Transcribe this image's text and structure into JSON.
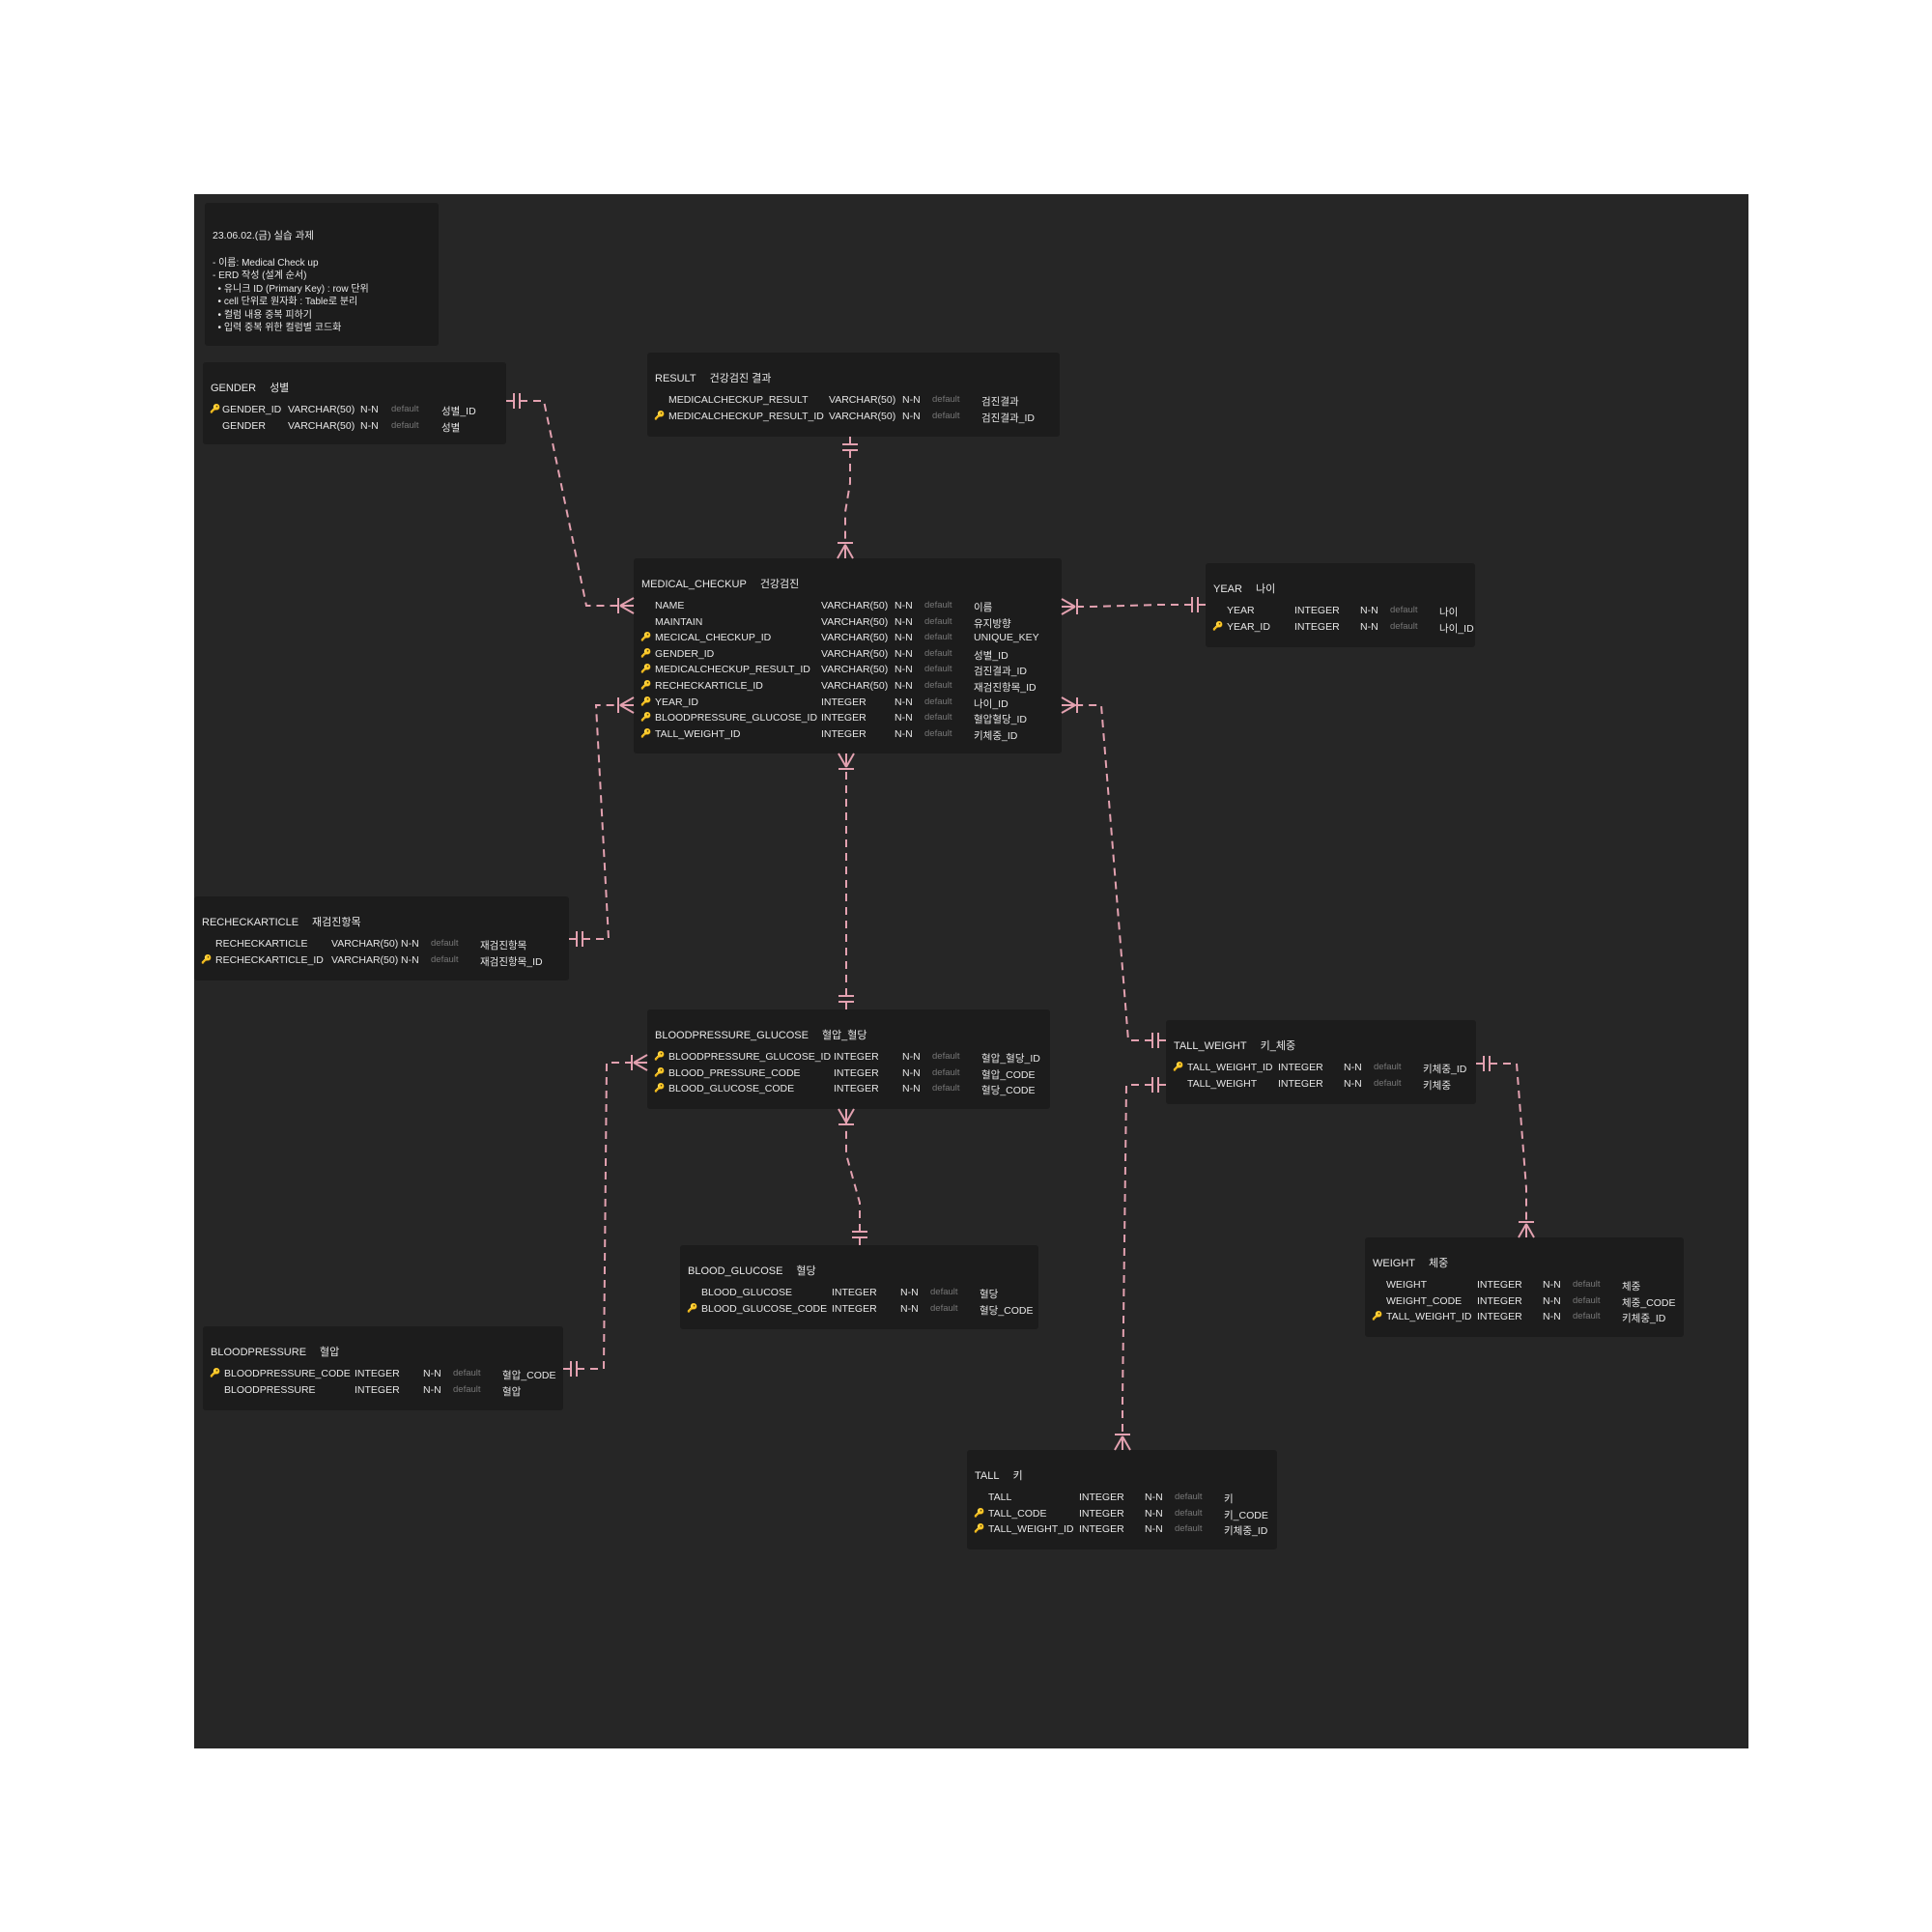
{
  "colors": {
    "canvas": "#262626",
    "table": "#1c1c1c",
    "relation": "#e3a1b0",
    "primary_key": "#d9c435",
    "foreign_key": "#d98ea0"
  },
  "memo": {
    "title": "23.06.02.(금)    실습 과제",
    "lines": [
      "- 이름: Medical Check up",
      "- ERD 작성 (설계 순서)",
      "  • 유니크 ID (Primary Key) : row 단위",
      "  • cell 단위로 원자화 : Table로 분리",
      "  • 컬럼 내용 중복 피하기",
      "  • 입력 중복 위한 컬럼별 코드화"
    ]
  },
  "tables": [
    {
      "id": "gender",
      "name": "GENDER",
      "logical": "성별",
      "columns": [
        {
          "key": "pk",
          "name": "GENDER_ID",
          "type": "VARCHAR(50)",
          "nn": "N-N",
          "default": "default",
          "comment": "성별_ID"
        },
        {
          "key": "",
          "name": "GENDER",
          "type": "VARCHAR(50)",
          "nn": "N-N",
          "default": "default",
          "comment": "성별"
        }
      ]
    },
    {
      "id": "result",
      "name": "RESULT",
      "logical": "건강검진 결과",
      "columns": [
        {
          "key": "",
          "name": "MEDICALCHECKUP_RESULT",
          "type": "VARCHAR(50)",
          "nn": "N-N",
          "default": "default",
          "comment": "검진결과"
        },
        {
          "key": "pk",
          "name": "MEDICALCHECKUP_RESULT_ID",
          "type": "VARCHAR(50)",
          "nn": "N-N",
          "default": "default",
          "comment": "검진결과_ID"
        }
      ]
    },
    {
      "id": "medical",
      "name": "MEDICAL_CHECKUP",
      "logical": "건강검진",
      "columns": [
        {
          "key": "",
          "name": "NAME",
          "type": "VARCHAR(50)",
          "nn": "N-N",
          "default": "default",
          "comment": "이름"
        },
        {
          "key": "",
          "name": "MAINTAIN",
          "type": "VARCHAR(50)",
          "nn": "N-N",
          "default": "default",
          "comment": "유지방향"
        },
        {
          "key": "pk",
          "name": "MECICAL_CHECKUP_ID",
          "type": "VARCHAR(50)",
          "nn": "N-N",
          "default": "default",
          "comment": "UNIQUE_KEY"
        },
        {
          "key": "fk",
          "name": "GENDER_ID",
          "type": "VARCHAR(50)",
          "nn": "N-N",
          "default": "default",
          "comment": "성별_ID"
        },
        {
          "key": "fk",
          "name": "MEDICALCHECKUP_RESULT_ID",
          "type": "VARCHAR(50)",
          "nn": "N-N",
          "default": "default",
          "comment": "검진결과_ID"
        },
        {
          "key": "fk",
          "name": "RECHECKARTICLE_ID",
          "type": "VARCHAR(50)",
          "nn": "N-N",
          "default": "default",
          "comment": "재검진항목_ID"
        },
        {
          "key": "fk",
          "name": "YEAR_ID",
          "type": "INTEGER",
          "nn": "N-N",
          "default": "default",
          "comment": "나이_ID"
        },
        {
          "key": "fk",
          "name": "BLOODPRESSURE_GLUCOSE_ID",
          "type": "INTEGER",
          "nn": "N-N",
          "default": "default",
          "comment": "혈압혈당_ID"
        },
        {
          "key": "fk",
          "name": "TALL_WEIGHT_ID",
          "type": "INTEGER",
          "nn": "N-N",
          "default": "default",
          "comment": "키체중_ID"
        }
      ]
    },
    {
      "id": "year",
      "name": "YEAR",
      "logical": "나이",
      "columns": [
        {
          "key": "",
          "name": "YEAR",
          "type": "INTEGER",
          "nn": "N-N",
          "default": "default",
          "comment": "나이"
        },
        {
          "key": "pk",
          "name": "YEAR_ID",
          "type": "INTEGER",
          "nn": "N-N",
          "default": "default",
          "comment": "나이_ID"
        }
      ]
    },
    {
      "id": "recheck",
      "name": "RECHECKARTICLE",
      "logical": "재검진항목",
      "columns": [
        {
          "key": "",
          "name": "RECHECKARTICLE",
          "type": "VARCHAR(50)",
          "nn": "N-N",
          "default": "default",
          "comment": "재검진항목"
        },
        {
          "key": "pk",
          "name": "RECHECKARTICLE_ID",
          "type": "VARCHAR(50)",
          "nn": "N-N",
          "default": "default",
          "comment": "재검진항목_ID"
        }
      ]
    },
    {
      "id": "bpg",
      "name": "BLOODPRESSURE_GLUCOSE",
      "logical": "혈압_혈당",
      "columns": [
        {
          "key": "pk",
          "name": "BLOODPRESSURE_GLUCOSE_ID",
          "type": "INTEGER",
          "nn": "N-N",
          "default": "default",
          "comment": "혈압_혈당_ID"
        },
        {
          "key": "fk",
          "name": "BLOOD_PRESSURE_CODE",
          "type": "INTEGER",
          "nn": "N-N",
          "default": "default",
          "comment": "혈압_CODE"
        },
        {
          "key": "fk",
          "name": "BLOOD_GLUCOSE_CODE",
          "type": "INTEGER",
          "nn": "N-N",
          "default": "default",
          "comment": "혈당_CODE"
        }
      ]
    },
    {
      "id": "tallweight",
      "name": "TALL_WEIGHT",
      "logical": "키_체중",
      "columns": [
        {
          "key": "pk",
          "name": "TALL_WEIGHT_ID",
          "type": "INTEGER",
          "nn": "N-N",
          "default": "default",
          "comment": "키체중_ID"
        },
        {
          "key": "",
          "name": "TALL_WEIGHT",
          "type": "INTEGER",
          "nn": "N-N",
          "default": "default",
          "comment": "키체중"
        }
      ]
    },
    {
      "id": "glucose",
      "name": "BLOOD_GLUCOSE",
      "logical": "혈당",
      "columns": [
        {
          "key": "",
          "name": "BLOOD_GLUCOSE",
          "type": "INTEGER",
          "nn": "N-N",
          "default": "default",
          "comment": "혈당"
        },
        {
          "key": "pk",
          "name": "BLOOD_GLUCOSE_CODE",
          "type": "INTEGER",
          "nn": "N-N",
          "default": "default",
          "comment": "혈당_CODE"
        }
      ]
    },
    {
      "id": "weight",
      "name": "WEIGHT",
      "logical": "체중",
      "columns": [
        {
          "key": "",
          "name": "WEIGHT",
          "type": "INTEGER",
          "nn": "N-N",
          "default": "default",
          "comment": "체중"
        },
        {
          "key": "",
          "name": "WEIGHT_CODE",
          "type": "INTEGER",
          "nn": "N-N",
          "default": "default",
          "comment": "체중_CODE"
        },
        {
          "key": "fk",
          "name": "TALL_WEIGHT_ID",
          "type": "INTEGER",
          "nn": "N-N",
          "default": "default",
          "comment": "키체중_ID"
        }
      ]
    },
    {
      "id": "bp",
      "name": "BLOODPRESSURE",
      "logical": "혈압",
      "columns": [
        {
          "key": "pk",
          "name": "BLOODPRESSURE_CODE",
          "type": "INTEGER",
          "nn": "N-N",
          "default": "default",
          "comment": "혈압_CODE"
        },
        {
          "key": "",
          "name": "BLOODPRESSURE",
          "type": "INTEGER",
          "nn": "N-N",
          "default": "default",
          "comment": "혈압"
        }
      ]
    },
    {
      "id": "tall",
      "name": "TALL",
      "logical": "키",
      "columns": [
        {
          "key": "",
          "name": "TALL",
          "type": "INTEGER",
          "nn": "N-N",
          "default": "default",
          "comment": "키"
        },
        {
          "key": "pk",
          "name": "TALL_CODE",
          "type": "INTEGER",
          "nn": "N-N",
          "default": "default",
          "comment": "키_CODE"
        },
        {
          "key": "fk",
          "name": "TALL_WEIGHT_ID",
          "type": "INTEGER",
          "nn": "N-N",
          "default": "default",
          "comment": "키체중_ID"
        }
      ]
    }
  ],
  "relationships": [
    {
      "from": "gender",
      "to": "medical",
      "from_card": "one",
      "to_card": "many"
    },
    {
      "from": "result",
      "to": "medical",
      "from_card": "one",
      "to_card": "many"
    },
    {
      "from": "year",
      "to": "medical",
      "from_card": "one",
      "to_card": "many"
    },
    {
      "from": "recheck",
      "to": "medical",
      "from_card": "one",
      "to_card": "many"
    },
    {
      "from": "bpg",
      "to": "medical",
      "from_card": "one",
      "to_card": "many"
    },
    {
      "from": "tallweight",
      "to": "medical",
      "from_card": "one",
      "to_card": "many"
    },
    {
      "from": "glucose",
      "to": "bpg",
      "from_card": "one",
      "to_card": "many"
    },
    {
      "from": "bp",
      "to": "bpg",
      "from_card": "one",
      "to_card": "many"
    },
    {
      "from": "tallweight",
      "to": "weight",
      "from_card": "one",
      "to_card": "many"
    },
    {
      "from": "tallweight",
      "to": "tall",
      "from_card": "one",
      "to_card": "many"
    }
  ]
}
